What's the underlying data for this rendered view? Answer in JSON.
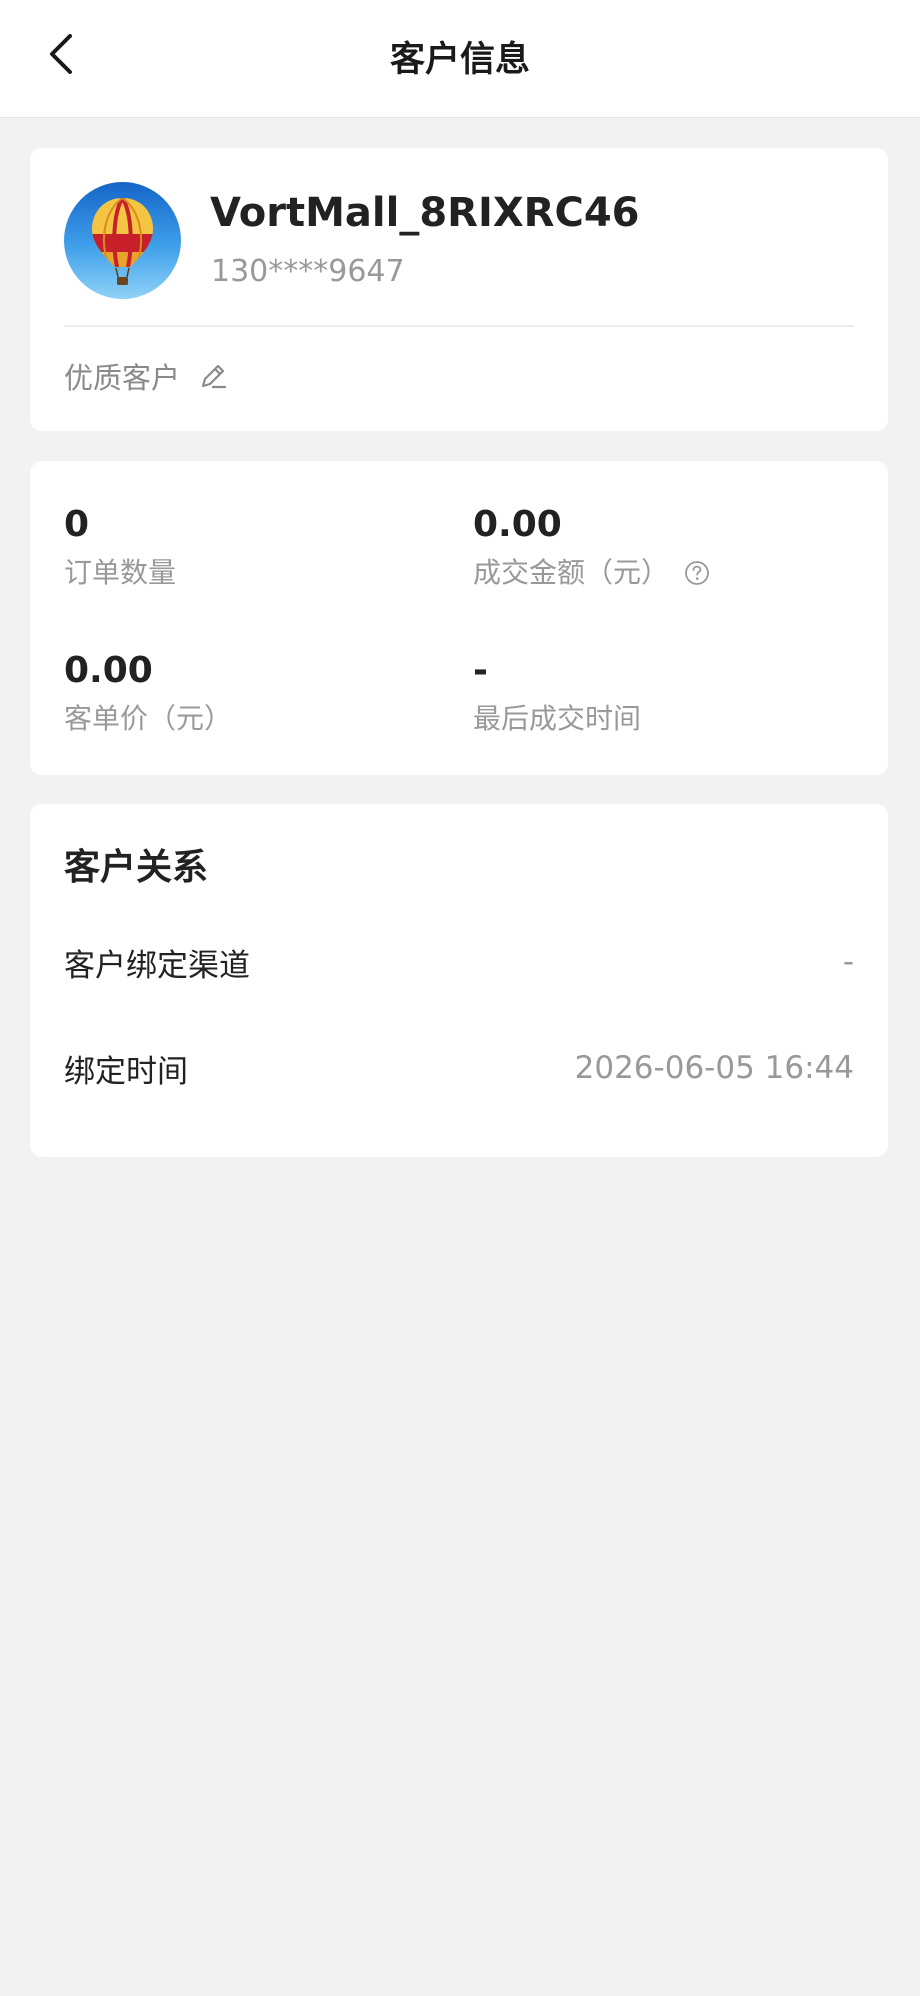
{
  "header": {
    "title": "客户信息",
    "back_icon": "chevron-left-icon"
  },
  "profile": {
    "avatar_icon": "hot-air-balloon-avatar",
    "name": "VortMall_8RIXRC46",
    "phone": "130****9647",
    "tag": "优质客户",
    "edit_icon": "pencil-icon"
  },
  "stats": {
    "orders": {
      "value": "0",
      "label": "订单数量"
    },
    "amount": {
      "value": "0.00",
      "label": "成交金额（元）",
      "help_icon": "question-circle-icon"
    },
    "avg_price": {
      "value": "0.00",
      "label": "客单价（元）"
    },
    "last_deal": {
      "value": "-",
      "label": "最后成交时间"
    }
  },
  "relationship": {
    "title": "客户关系",
    "rows": [
      {
        "label": "客户绑定渠道",
        "value": "-"
      },
      {
        "label": "绑定时间",
        "value": "2026-06-05 16:44"
      }
    ]
  },
  "colors": {
    "background": "#f2f2f2",
    "card": "#ffffff",
    "text_primary": "#222222",
    "text_secondary": "#999999"
  }
}
